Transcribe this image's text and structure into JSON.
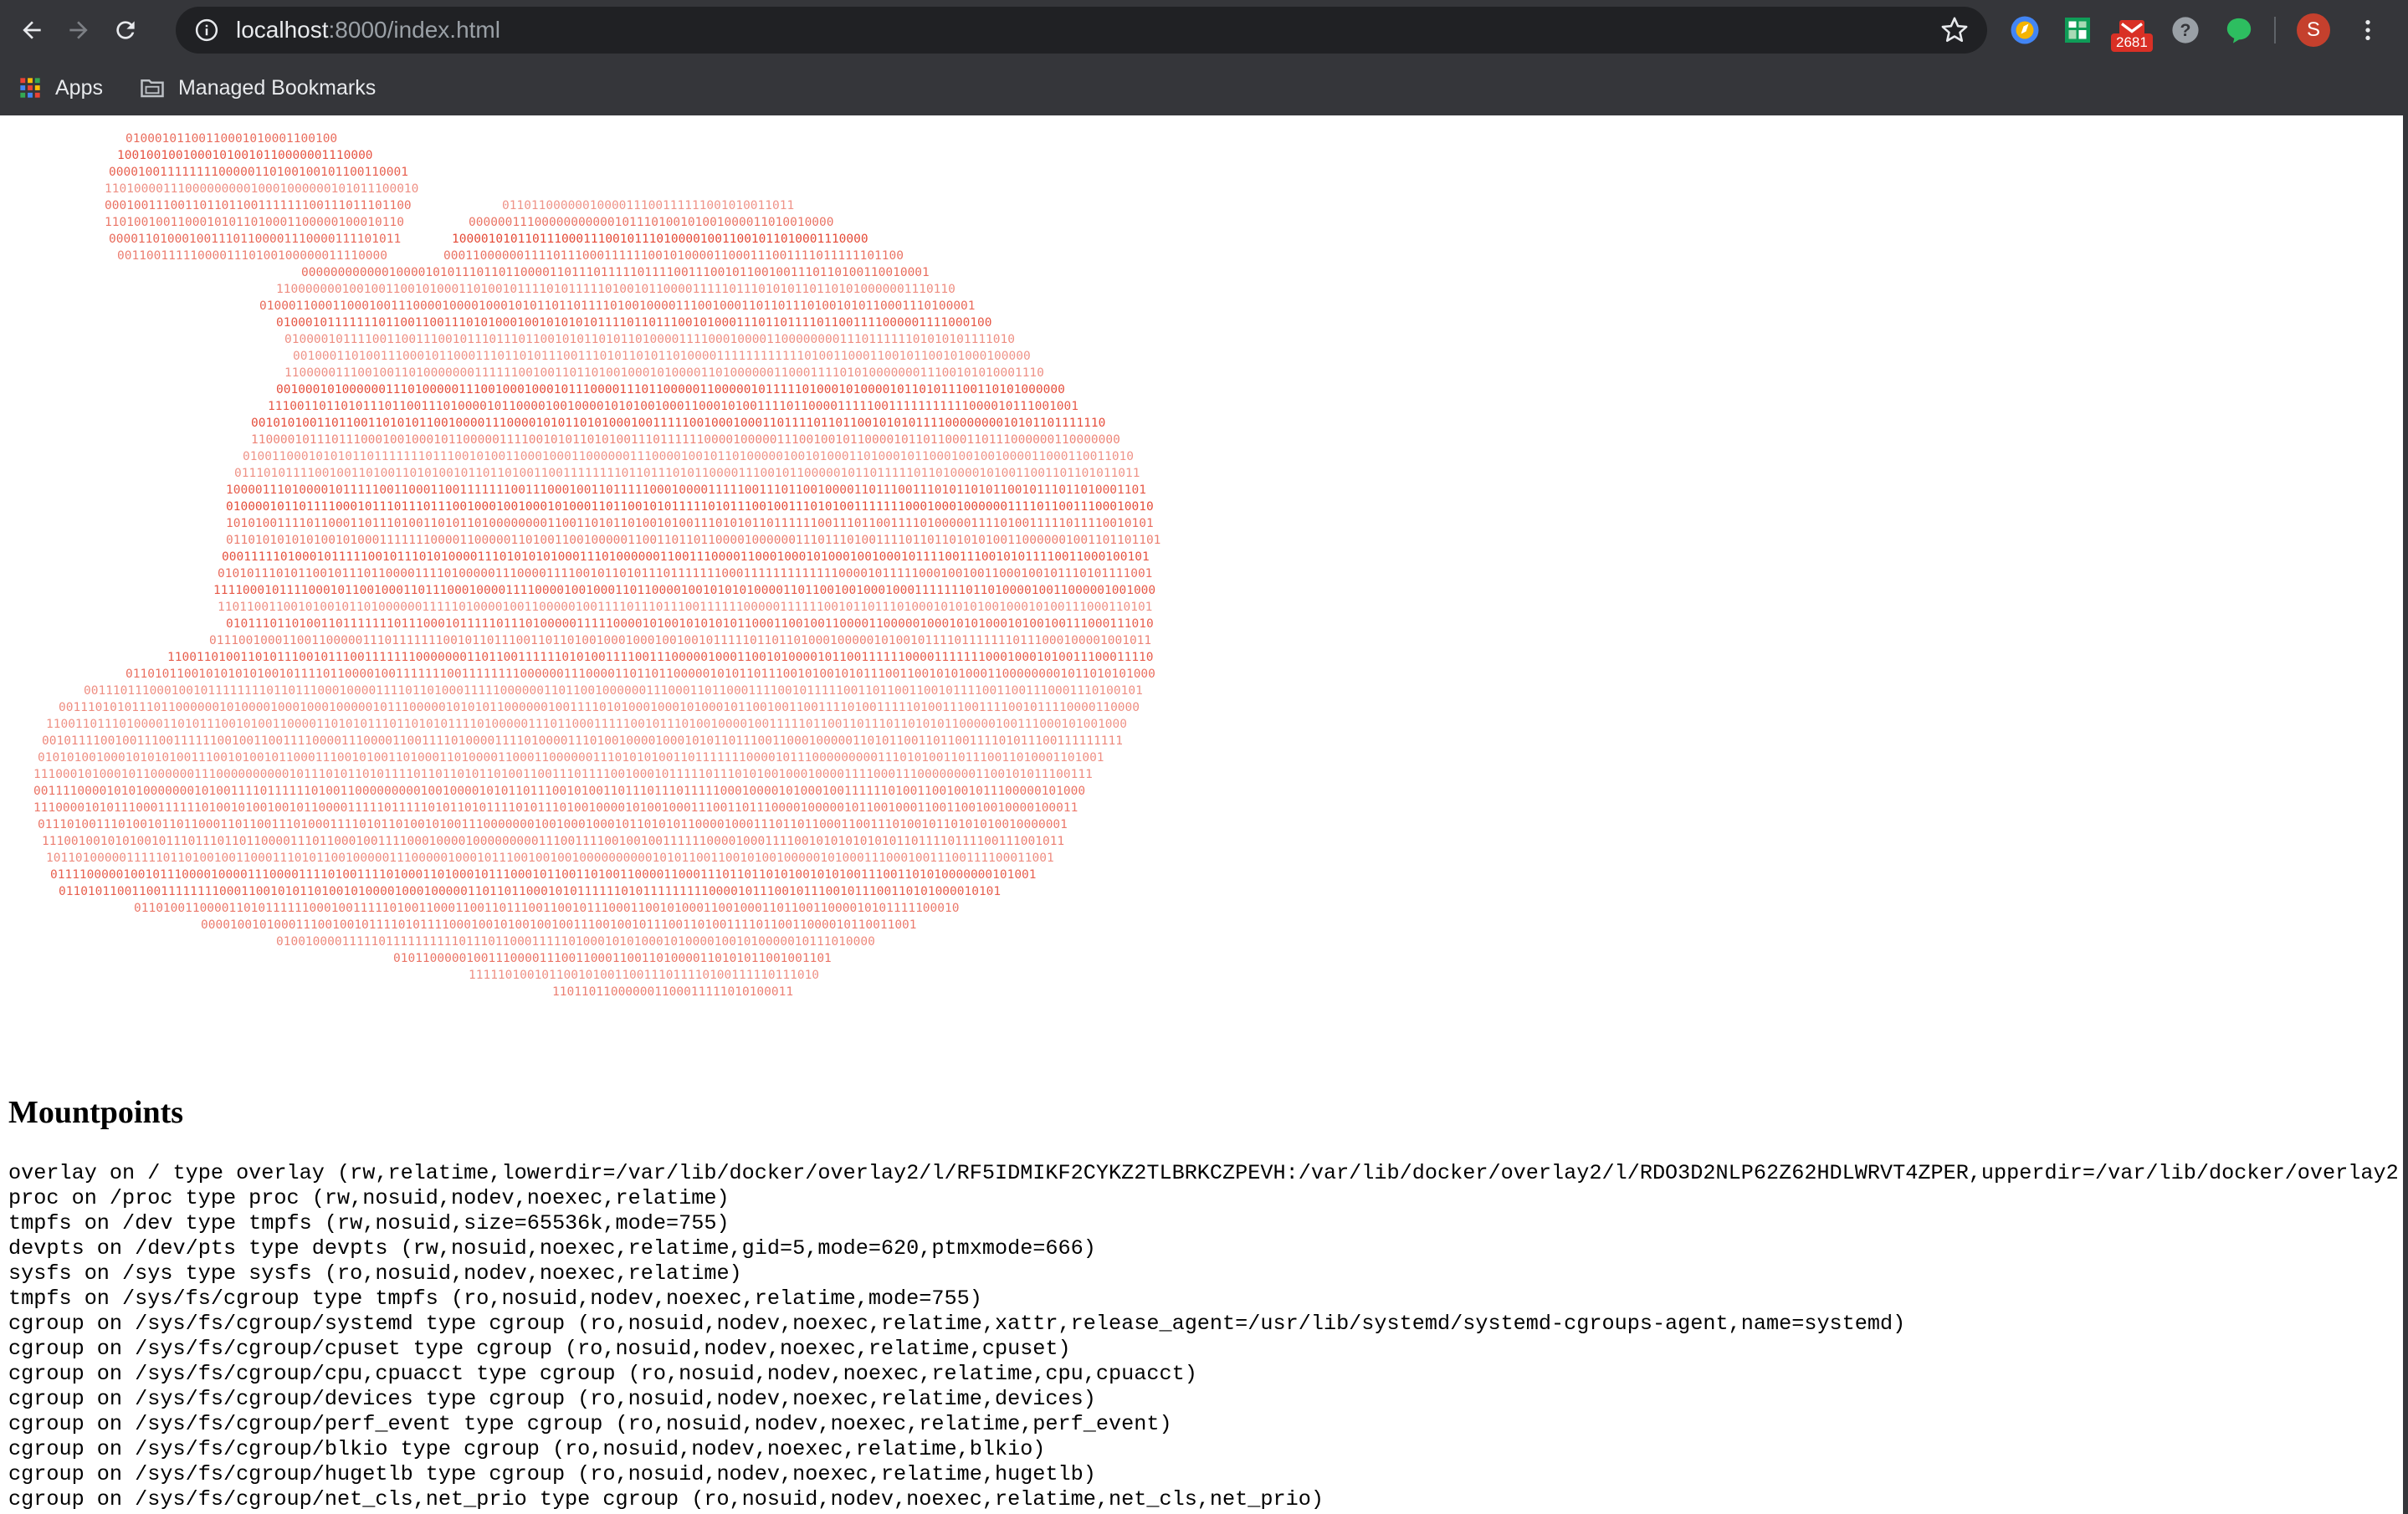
{
  "browser": {
    "url_host": "localhost",
    "url_path": ":8000/index.html",
    "bookmarks": [
      {
        "label": "Apps",
        "icon": "apps-grid-icon"
      },
      {
        "label": "Managed Bookmarks",
        "icon": "folder-icon"
      }
    ],
    "extensions": [
      {
        "icon": "chrome-extension-compass-icon",
        "color": "#f4b400"
      },
      {
        "icon": "sheets-extension-icon",
        "color": "#0f9d58"
      },
      {
        "icon": "gmail-extension-icon",
        "color": "#d93025",
        "badge": "2681"
      },
      {
        "icon": "help-extension-icon",
        "color": "#9aa0a6"
      },
      {
        "icon": "evernote-extension-icon",
        "color": "#2dbe60"
      }
    ],
    "profile_initial": "S",
    "profile_color": "#c5402d"
  },
  "ascii_art": {
    "description_icon": "penguin-ascii-art",
    "color": "#e3402c"
  },
  "page": {
    "heading": "Mountpoints",
    "mounts": [
      "overlay on / type overlay (rw,relatime,lowerdir=/var/lib/docker/overlay2/l/RF5IDMIKF2CYKZ2TLBRKCZPEVH:/var/lib/docker/overlay2/l/RDO3D2NLP62Z62HDLWRVT4ZPER,upperdir=/var/lib/docker/overlay2",
      "proc on /proc type proc (rw,nosuid,nodev,noexec,relatime)",
      "tmpfs on /dev type tmpfs (rw,nosuid,size=65536k,mode=755)",
      "devpts on /dev/pts type devpts (rw,nosuid,noexec,relatime,gid=5,mode=620,ptmxmode=666)",
      "sysfs on /sys type sysfs (ro,nosuid,nodev,noexec,relatime)",
      "tmpfs on /sys/fs/cgroup type tmpfs (ro,nosuid,nodev,noexec,relatime,mode=755)",
      "cgroup on /sys/fs/cgroup/systemd type cgroup (ro,nosuid,nodev,noexec,relatime,xattr,release_agent=/usr/lib/systemd/systemd-cgroups-agent,name=systemd)",
      "cgroup on /sys/fs/cgroup/cpuset type cgroup (ro,nosuid,nodev,noexec,relatime,cpuset)",
      "cgroup on /sys/fs/cgroup/cpu,cpuacct type cgroup (ro,nosuid,nodev,noexec,relatime,cpu,cpuacct)",
      "cgroup on /sys/fs/cgroup/devices type cgroup (ro,nosuid,nodev,noexec,relatime,devices)",
      "cgroup on /sys/fs/cgroup/perf_event type cgroup (ro,nosuid,nodev,noexec,relatime,perf_event)",
      "cgroup on /sys/fs/cgroup/blkio type cgroup (ro,nosuid,nodev,noexec,relatime,blkio)",
      "cgroup on /sys/fs/cgroup/hugetlb type cgroup (ro,nosuid,nodev,noexec,relatime,hugetlb)",
      "cgroup on /sys/fs/cgroup/net_cls,net_prio type cgroup (ro,nosuid,nodev,noexec,relatime,net_cls,net_prio)"
    ]
  }
}
